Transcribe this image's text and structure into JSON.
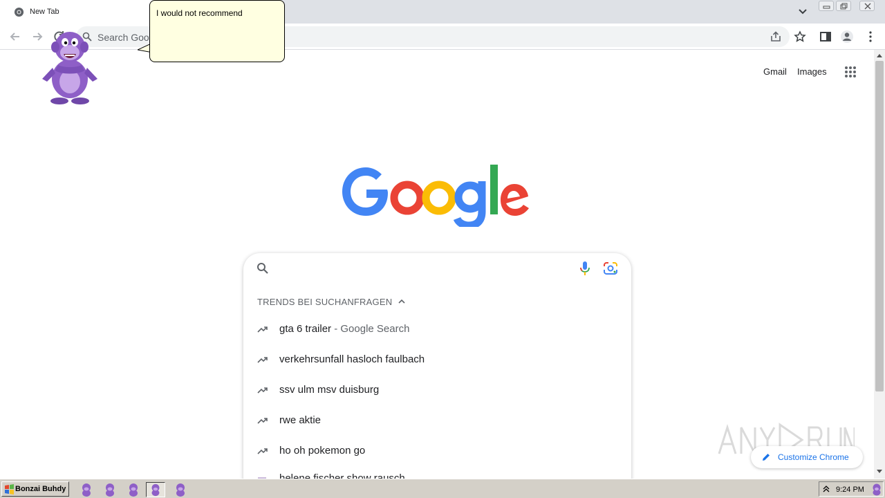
{
  "browser": {
    "tab": {
      "title": "New Tab"
    },
    "omnibox": {
      "placeholder": "Search Google or type a URL"
    }
  },
  "page": {
    "top_links": [
      "Gmail",
      "Images"
    ],
    "trends_heading": "TRENDS BEI SUCHANFRAGEN",
    "suggestions": [
      {
        "text": "gta 6 trailer",
        "suffix": " - Google Search"
      },
      {
        "text": "verkehrsunfall hasloch faulbach",
        "suffix": ""
      },
      {
        "text": "ssv ulm msv duisburg",
        "suffix": ""
      },
      {
        "text": "rwe aktie",
        "suffix": ""
      },
      {
        "text": "ho oh pokemon go",
        "suffix": ""
      },
      {
        "text": "helene fischer show rausch",
        "suffix": ""
      }
    ],
    "customize_label": "Customize Chrome"
  },
  "bonzi": {
    "speech": "I would not recommend"
  },
  "taskbar": {
    "start_label": "Bonzai Buhdy",
    "clock": "9:24 PM"
  },
  "colors": {
    "google_blue": "#4285f4",
    "google_red": "#ea4335",
    "google_yellow": "#fbbc05",
    "google_green": "#34a853",
    "bonzi_purple": "#8e5fc7",
    "bubble_bg": "#ffffe1"
  }
}
